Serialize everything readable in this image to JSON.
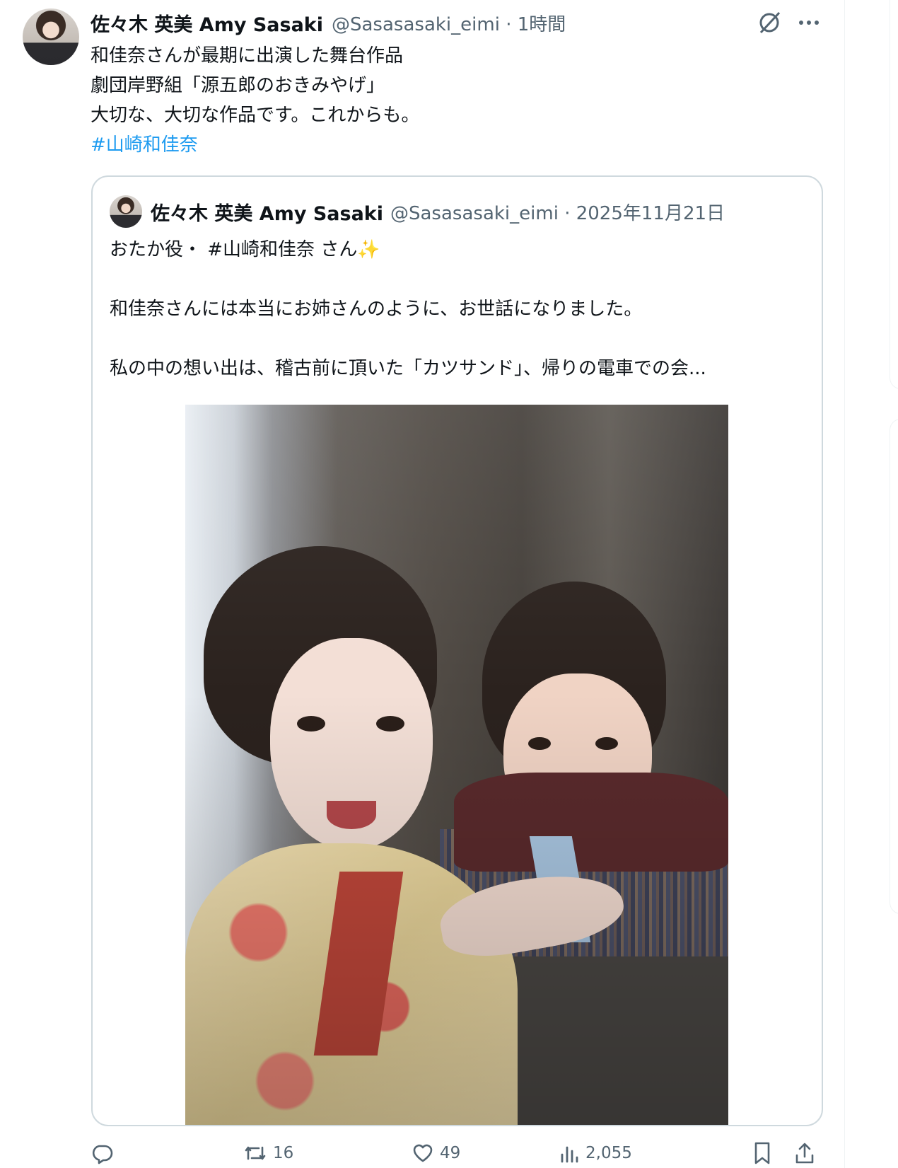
{
  "tweet": {
    "display_name": "佐々木 英美 Amy Sasaki",
    "handle_time": "@Sasasasaki_eimi · 1時間",
    "lines": [
      "和佳奈さんが最期に出演した舞台作品",
      "劇団岸野組「源五郎のおきみやげ」",
      "大切な、大切な作品です。これからも。"
    ],
    "hashtag": "#山崎和佳奈"
  },
  "quote": {
    "display_name": "佐々木 英美 Amy Sasaki",
    "handle_time": "@Sasasasaki_eimi · 2025年11月21日",
    "line1": "おたか役・ #山崎和佳奈 さん",
    "sparkle": "✨",
    "line2": "和佳奈さんには本当にお姉さんのように、お世話になりました。",
    "line3": "私の中の想い出は、稽古前に頂いた「カツサンド」、帰りの電車での会..."
  },
  "actions": {
    "retweets": "16",
    "likes": "49",
    "views": "2,055"
  },
  "icons": {
    "header": [
      "grok-icon",
      "more-icon"
    ],
    "action_bar": [
      "reply-icon",
      "retweet-icon",
      "like-icon",
      "views-icon",
      "bookmark-icon",
      "share-icon"
    ]
  },
  "colors": {
    "text": "#0f1419",
    "secondary": "#536471",
    "link": "#1d9bf0",
    "border": "#cfd9de"
  }
}
